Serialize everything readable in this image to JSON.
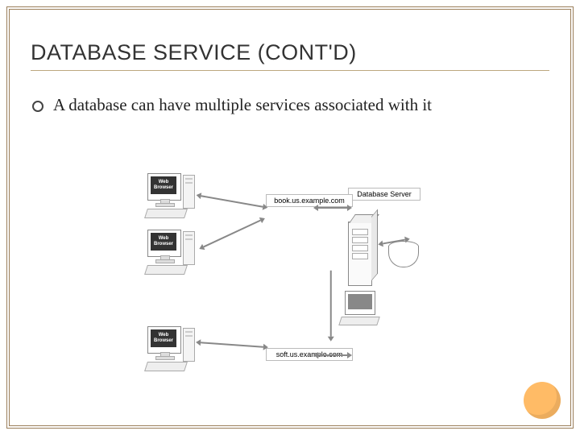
{
  "title": "DATABASE SERVICE (CONT'D)",
  "bullets": [
    "A database can have multiple services associated with it"
  ],
  "diagram": {
    "clients": [
      {
        "label_line1": "Web",
        "label_line2": "Browser"
      },
      {
        "label_line1": "Web",
        "label_line2": "Browser"
      },
      {
        "label_line1": "Web",
        "label_line2": "Browser"
      }
    ],
    "services": [
      {
        "host": "book.us.example.com"
      },
      {
        "host": "soft.us.example.com"
      }
    ],
    "server_label": "Database Server"
  }
}
